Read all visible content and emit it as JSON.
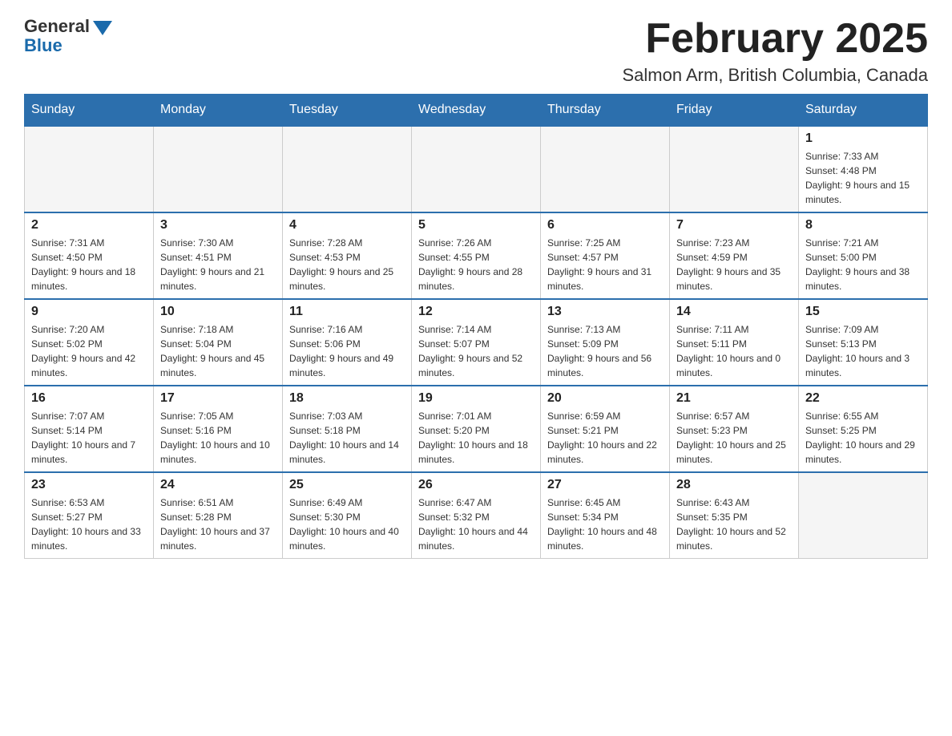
{
  "logo": {
    "general": "General",
    "blue": "Blue"
  },
  "header": {
    "title": "February 2025",
    "subtitle": "Salmon Arm, British Columbia, Canada"
  },
  "days_of_week": [
    "Sunday",
    "Monday",
    "Tuesday",
    "Wednesday",
    "Thursday",
    "Friday",
    "Saturday"
  ],
  "weeks": [
    [
      {
        "day": "",
        "info": ""
      },
      {
        "day": "",
        "info": ""
      },
      {
        "day": "",
        "info": ""
      },
      {
        "day": "",
        "info": ""
      },
      {
        "day": "",
        "info": ""
      },
      {
        "day": "",
        "info": ""
      },
      {
        "day": "1",
        "info": "Sunrise: 7:33 AM\nSunset: 4:48 PM\nDaylight: 9 hours and 15 minutes."
      }
    ],
    [
      {
        "day": "2",
        "info": "Sunrise: 7:31 AM\nSunset: 4:50 PM\nDaylight: 9 hours and 18 minutes."
      },
      {
        "day": "3",
        "info": "Sunrise: 7:30 AM\nSunset: 4:51 PM\nDaylight: 9 hours and 21 minutes."
      },
      {
        "day": "4",
        "info": "Sunrise: 7:28 AM\nSunset: 4:53 PM\nDaylight: 9 hours and 25 minutes."
      },
      {
        "day": "5",
        "info": "Sunrise: 7:26 AM\nSunset: 4:55 PM\nDaylight: 9 hours and 28 minutes."
      },
      {
        "day": "6",
        "info": "Sunrise: 7:25 AM\nSunset: 4:57 PM\nDaylight: 9 hours and 31 minutes."
      },
      {
        "day": "7",
        "info": "Sunrise: 7:23 AM\nSunset: 4:59 PM\nDaylight: 9 hours and 35 minutes."
      },
      {
        "day": "8",
        "info": "Sunrise: 7:21 AM\nSunset: 5:00 PM\nDaylight: 9 hours and 38 minutes."
      }
    ],
    [
      {
        "day": "9",
        "info": "Sunrise: 7:20 AM\nSunset: 5:02 PM\nDaylight: 9 hours and 42 minutes."
      },
      {
        "day": "10",
        "info": "Sunrise: 7:18 AM\nSunset: 5:04 PM\nDaylight: 9 hours and 45 minutes."
      },
      {
        "day": "11",
        "info": "Sunrise: 7:16 AM\nSunset: 5:06 PM\nDaylight: 9 hours and 49 minutes."
      },
      {
        "day": "12",
        "info": "Sunrise: 7:14 AM\nSunset: 5:07 PM\nDaylight: 9 hours and 52 minutes."
      },
      {
        "day": "13",
        "info": "Sunrise: 7:13 AM\nSunset: 5:09 PM\nDaylight: 9 hours and 56 minutes."
      },
      {
        "day": "14",
        "info": "Sunrise: 7:11 AM\nSunset: 5:11 PM\nDaylight: 10 hours and 0 minutes."
      },
      {
        "day": "15",
        "info": "Sunrise: 7:09 AM\nSunset: 5:13 PM\nDaylight: 10 hours and 3 minutes."
      }
    ],
    [
      {
        "day": "16",
        "info": "Sunrise: 7:07 AM\nSunset: 5:14 PM\nDaylight: 10 hours and 7 minutes."
      },
      {
        "day": "17",
        "info": "Sunrise: 7:05 AM\nSunset: 5:16 PM\nDaylight: 10 hours and 10 minutes."
      },
      {
        "day": "18",
        "info": "Sunrise: 7:03 AM\nSunset: 5:18 PM\nDaylight: 10 hours and 14 minutes."
      },
      {
        "day": "19",
        "info": "Sunrise: 7:01 AM\nSunset: 5:20 PM\nDaylight: 10 hours and 18 minutes."
      },
      {
        "day": "20",
        "info": "Sunrise: 6:59 AM\nSunset: 5:21 PM\nDaylight: 10 hours and 22 minutes."
      },
      {
        "day": "21",
        "info": "Sunrise: 6:57 AM\nSunset: 5:23 PM\nDaylight: 10 hours and 25 minutes."
      },
      {
        "day": "22",
        "info": "Sunrise: 6:55 AM\nSunset: 5:25 PM\nDaylight: 10 hours and 29 minutes."
      }
    ],
    [
      {
        "day": "23",
        "info": "Sunrise: 6:53 AM\nSunset: 5:27 PM\nDaylight: 10 hours and 33 minutes."
      },
      {
        "day": "24",
        "info": "Sunrise: 6:51 AM\nSunset: 5:28 PM\nDaylight: 10 hours and 37 minutes."
      },
      {
        "day": "25",
        "info": "Sunrise: 6:49 AM\nSunset: 5:30 PM\nDaylight: 10 hours and 40 minutes."
      },
      {
        "day": "26",
        "info": "Sunrise: 6:47 AM\nSunset: 5:32 PM\nDaylight: 10 hours and 44 minutes."
      },
      {
        "day": "27",
        "info": "Sunrise: 6:45 AM\nSunset: 5:34 PM\nDaylight: 10 hours and 48 minutes."
      },
      {
        "day": "28",
        "info": "Sunrise: 6:43 AM\nSunset: 5:35 PM\nDaylight: 10 hours and 52 minutes."
      },
      {
        "day": "",
        "info": ""
      }
    ]
  ]
}
